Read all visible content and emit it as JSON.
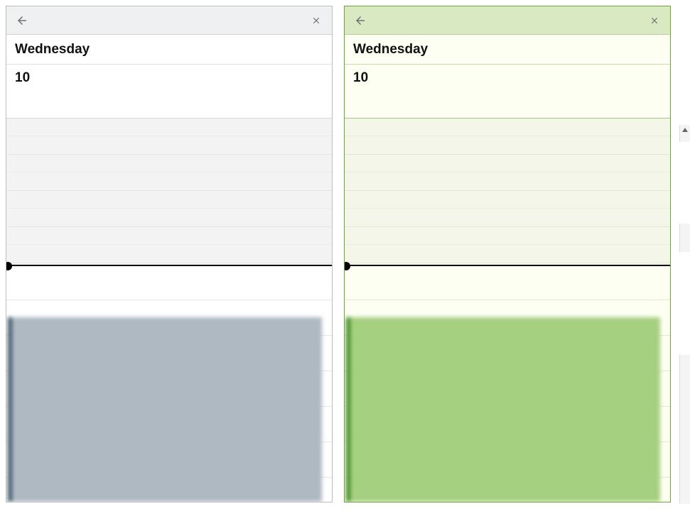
{
  "panels": [
    {
      "theme": "blue",
      "day_name": "Wednesday",
      "day_number": "10",
      "event": {
        "line1": "",
        "line2": "",
        "line3": ""
      },
      "colors": {
        "accent": "#3c5668",
        "fill": "#aeb9c1"
      }
    },
    {
      "theme": "green",
      "day_name": "Wednesday",
      "day_number": "10",
      "event": {
        "line1": "",
        "line2": "",
        "line3": ""
      },
      "colors": {
        "accent": "#3e8a1d",
        "fill": "#a4d07f"
      }
    }
  ],
  "icons": {
    "back": "back-arrow-icon",
    "close": "close-icon"
  }
}
